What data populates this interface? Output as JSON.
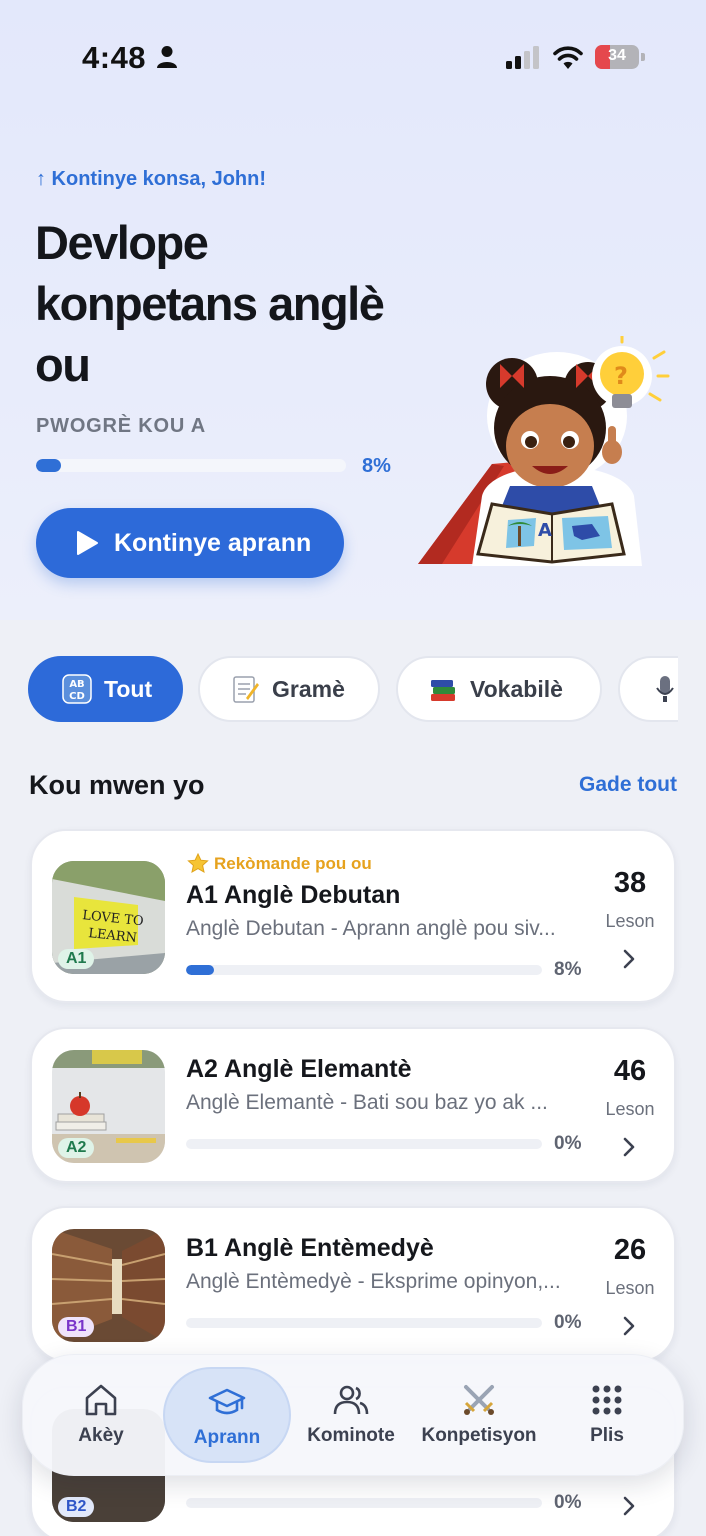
{
  "status_bar": {
    "time": "4:48",
    "battery": "34",
    "battery_level": 0.34
  },
  "hero": {
    "greeting": "↑ Kontinye konsa, John!",
    "title": "Devlope konpetans anglè ou",
    "progress_label": "PWOGRÈ KOU A",
    "progress_value": 8,
    "progress_text": "8%",
    "continue_button": "Kontinye aprann",
    "mascot": "girl-reading-book-mascot-with-lightbulb"
  },
  "filters": [
    {
      "label": "Tout",
      "icon": "abcd-icon",
      "active": true
    },
    {
      "label": "Gramè",
      "icon": "memo-icon",
      "active": false
    },
    {
      "label": "Vokabilè",
      "icon": "books-icon",
      "active": false
    },
    {
      "label": "",
      "icon": "microphone-icon",
      "active": false
    }
  ],
  "section": {
    "title": "Kou mwen yo",
    "see_all": "Gade tout"
  },
  "courses": [
    {
      "recommended": "Rekòmande pou ou",
      "title": "A1 Anglè Debutan",
      "desc": "Anglè Debutan - Aprann anglè pou siv...",
      "progress": 8,
      "progress_text": "8%",
      "lessons": "38",
      "lessons_label": "Leson",
      "level": "A1",
      "level_color": "#1f7a4d",
      "level_bg": "#dff3e8"
    },
    {
      "title": "A2 Anglè Elemantè",
      "desc": "Anglè Elemantè - Bati sou baz yo ak ...",
      "progress": 0,
      "progress_text": "0%",
      "lessons": "46",
      "lessons_label": "Leson",
      "level": "A2",
      "level_color": "#1f7a4d",
      "level_bg": "#dff3e8"
    },
    {
      "title": "B1 Anglè Entèmedyè",
      "desc": "Anglè Entèmedyè - Eksprime opinyon,...",
      "progress": 0,
      "progress_text": "0%",
      "lessons": "26",
      "lessons_label": "Leson",
      "level": "B1",
      "level_color": "#7a35c9",
      "level_bg": "#efe3fb"
    },
    {
      "title": "",
      "desc": "",
      "progress": 0,
      "progress_text": "0%",
      "lessons": "",
      "lessons_label": "",
      "level": "B2",
      "level_color": "#2f56c9",
      "level_bg": "#e2e9fb"
    }
  ],
  "tabs": [
    {
      "label": "Akèy",
      "icon": "home-icon",
      "active": false
    },
    {
      "label": "Aprann",
      "icon": "graduation-cap-icon",
      "active": true
    },
    {
      "label": "Kominote",
      "icon": "people-icon",
      "active": false
    },
    {
      "label": "Konpetisyon",
      "icon": "crossed-swords-icon",
      "active": false
    },
    {
      "label": "Plis",
      "icon": "grid-dots-icon",
      "active": false
    }
  ],
  "colors": {
    "accent": "#2d6ad9",
    "recommend": "#e6a21e"
  }
}
